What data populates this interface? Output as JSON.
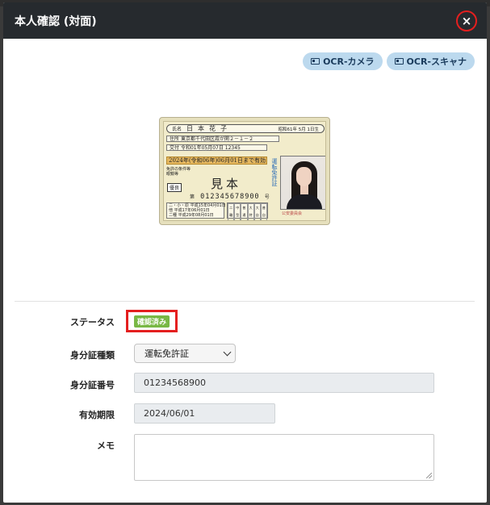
{
  "background": {
    "top_text": [
      "…",
      "…"
    ]
  },
  "modal": {
    "title": "本人確認 (対面)",
    "close_symbol": "×"
  },
  "ocr_buttons": [
    {
      "label": "OCR-カメラ",
      "icon": "id-card-icon"
    },
    {
      "label": "OCR-スキャナ",
      "icon": "id-card-icon"
    }
  ],
  "license": {
    "name_label": "氏名",
    "name": "日本花子",
    "birth": "昭和61年 5月 1日生",
    "address_label": "住所",
    "address": "東京都千代田区霞が関２－１－２",
    "issue_label": "交付",
    "issue": "令和01年05月07日 12345",
    "expiry": "2024年(令和06年)06月01日まで有効",
    "conditions": "免許の条件等\n眼鏡等",
    "excellent": "優良",
    "sample": "見本",
    "number_prefix": "第",
    "number": "012345678900",
    "number_suffix": "号",
    "dates": "二・小・原 平成15年04月01日\n他 平成17年06月01日\n二種 平成29年08月01日",
    "grid": [
      "二輪",
      "中型",
      "普通",
      "大特",
      "大自二",
      "普自二",
      "小特",
      "原付",
      "け引",
      "大二",
      "中二",
      "普二"
    ],
    "vertical": "運転免許証",
    "seal": "公安委員会"
  },
  "form": {
    "status": {
      "label": "ステータス",
      "value": "確認済み"
    },
    "id_type": {
      "label": "身分証種類",
      "value": "運転免許証"
    },
    "id_number": {
      "label": "身分証番号",
      "value": "01234568900"
    },
    "expiry": {
      "label": "有効期限",
      "value": "2024/06/01"
    },
    "memo": {
      "label": "メモ",
      "value": ""
    }
  },
  "colors": {
    "header_bg": "#262a2e",
    "highlight_red": "#e41f1f",
    "ocr_btn_bg": "#bcd9ee",
    "status_green": "#79b845"
  }
}
